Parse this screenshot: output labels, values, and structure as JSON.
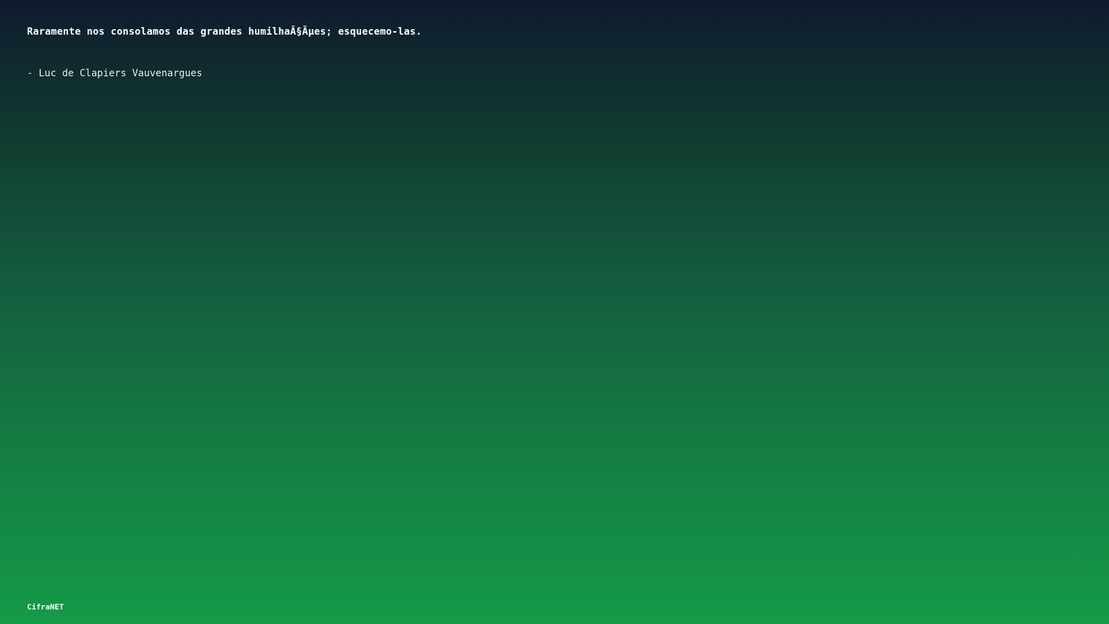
{
  "quote": {
    "text": "Raramente nos consolamos das grandes humilhaÃ§Ãµes; esquecemo-las.",
    "author": "- Luc de Clapiers Vauvenargues"
  },
  "footer": {
    "brand": "CifraNET"
  }
}
